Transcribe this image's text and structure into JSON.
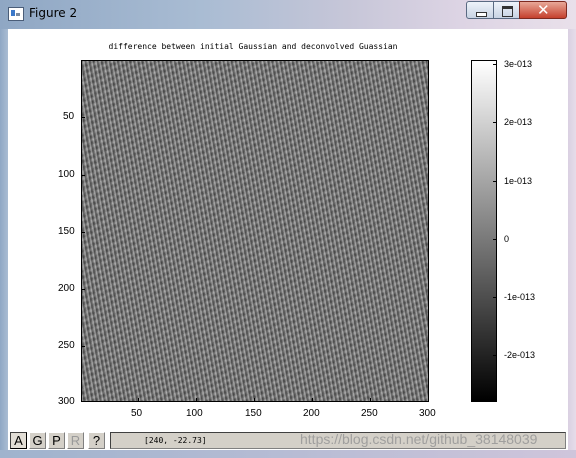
{
  "window": {
    "title": "Figure 2",
    "controls": {
      "minimize": "minimize-icon",
      "maximize": "maximize-icon",
      "close": "close-icon"
    }
  },
  "plot": {
    "title": "difference between initial Gaussian and deconvolved Guassian",
    "x_ticks": [
      "50",
      "100",
      "150",
      "200",
      "250",
      "300"
    ],
    "y_ticks": [
      "50",
      "100",
      "150",
      "200",
      "250",
      "300"
    ]
  },
  "chart_data": {
    "type": "heatmap",
    "title": "difference between initial Gaussian and deconvolved Guassian",
    "xlim": [
      1,
      300
    ],
    "ylim": [
      1,
      300
    ],
    "x_ticks": [
      50,
      100,
      150,
      200,
      250,
      300
    ],
    "y_ticks": [
      50,
      100,
      150,
      200,
      250,
      300
    ],
    "y_axis_direction": "downward",
    "colormap": "gray",
    "colorbar": {
      "ticks": [
        "3e-013",
        "2e-013",
        "1e-013",
        "0",
        "-1e-013",
        "-2e-013"
      ],
      "range": [
        -2.9e-13,
        3.05e-13
      ]
    },
    "pattern": "fine diagonal stripe noise"
  },
  "toolbar": {
    "buttons": [
      {
        "label": "A",
        "state": "active"
      },
      {
        "label": "G",
        "state": "normal"
      },
      {
        "label": "P",
        "state": "normal"
      },
      {
        "label": "R",
        "state": "disabled"
      },
      {
        "label": "?",
        "state": "normal"
      }
    ]
  },
  "status": {
    "coordinates": "[240, -22.73]"
  },
  "watermark": "https://blog.csdn.net/github_38148039"
}
